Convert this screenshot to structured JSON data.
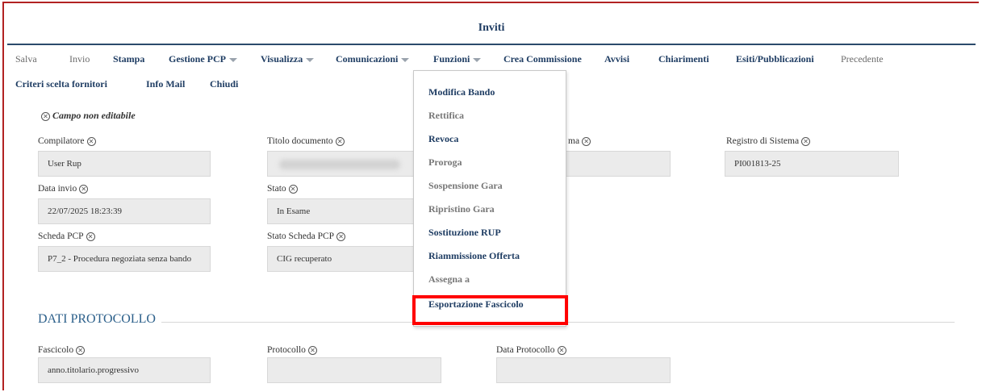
{
  "window": {
    "title": "Inviti"
  },
  "toolbar": {
    "items": [
      {
        "label": "Salva"
      },
      {
        "label": "Invio"
      },
      {
        "label": "Stampa"
      },
      {
        "label": "Gestione PCP"
      },
      {
        "label": "Visualizza"
      },
      {
        "label": "Comunicazioni"
      },
      {
        "label": "Funzioni"
      },
      {
        "label": "Crea Commissione"
      },
      {
        "label": "Avvisi"
      },
      {
        "label": "Chiarimenti"
      },
      {
        "label": "Esiti/Pubblicazioni"
      },
      {
        "label": "Precedente"
      },
      {
        "label": "Criteri scelta fornitori"
      },
      {
        "label": "Info Mail"
      },
      {
        "label": "Chiudi"
      }
    ]
  },
  "note": {
    "text": "Campo non editabile",
    "icon": "circle-x-icon"
  },
  "fields": {
    "compilatore": {
      "label": "Compilatore",
      "value": "User Rup"
    },
    "titolo_documento": {
      "label": "Titolo documento",
      "value": ""
    },
    "registro_partial": {
      "label": "ma",
      "value": ""
    },
    "registro_sistema": {
      "label": "Registro di Sistema",
      "value": "PI001813-25"
    },
    "data_invio": {
      "label": "Data invio",
      "value": "22/07/2025 18:23:39"
    },
    "stato": {
      "label": "Stato",
      "value": "In Esame"
    },
    "scheda_pcp": {
      "label": "Scheda PCP",
      "value": "P7_2 - Procedura negoziata senza bando"
    },
    "stato_scheda_pcp": {
      "label": "Stato Scheda PCP",
      "value": "CIG recuperato"
    }
  },
  "section": {
    "title": "DATI PROTOCOLLO"
  },
  "protocol_fields": {
    "fascicolo": {
      "label": "Fascicolo",
      "value": "anno.titolario.progressivo"
    },
    "protocollo": {
      "label": "Protocollo",
      "value": ""
    },
    "data_protocollo": {
      "label": "Data Protocollo",
      "value": ""
    }
  },
  "menu": {
    "items": [
      {
        "label": "Modifica Bando"
      },
      {
        "label": "Rettifica"
      },
      {
        "label": "Revoca"
      },
      {
        "label": "Proroga"
      },
      {
        "label": "Sospensione Gara"
      },
      {
        "label": "Ripristino Gara"
      },
      {
        "label": "Sostituzione RUP"
      },
      {
        "label": "Riammissione Offerta"
      },
      {
        "label": "Assegna a"
      },
      {
        "label": "Esportazione Fascicolo"
      }
    ]
  },
  "colors": {
    "highlight": "#ff0000",
    "accent": "#1f3d63",
    "frame": "#b22222"
  }
}
